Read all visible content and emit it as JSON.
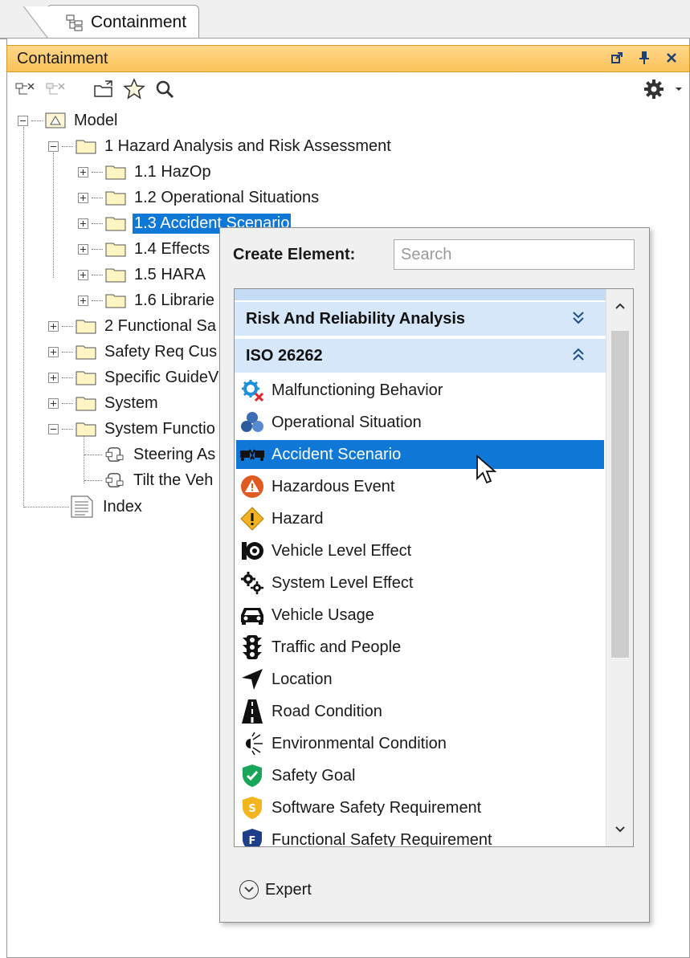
{
  "tab": {
    "label": "Containment",
    "icon": "containment-tree-icon"
  },
  "panel": {
    "title": "Containment",
    "window_buttons": [
      "restore-icon",
      "pin-icon",
      "close-icon"
    ]
  },
  "toolbar": {
    "icons": [
      "collapse-all-icon",
      "expand-all-icon",
      "open-project-icon",
      "favorite-star-icon",
      "search-icon",
      "gear-icon",
      "dropdown-arrow-icon"
    ]
  },
  "tree": {
    "root": "Model",
    "nodes": [
      {
        "label": "1 Hazard Analysis and Risk Assessment"
      },
      {
        "label": "1.1 HazOp"
      },
      {
        "label": "1.2 Operational Situations"
      },
      {
        "label": "1.3 Accident Scenario",
        "selected": true
      },
      {
        "label": "1.4 Effects"
      },
      {
        "label": "1.5 HARA"
      },
      {
        "label": "1.6 Librarie"
      },
      {
        "label": "2 Functional Sa"
      },
      {
        "label": "Safety Req Cus"
      },
      {
        "label": "Specific GuideV"
      },
      {
        "label": "System"
      },
      {
        "label": "System Functio"
      },
      {
        "label": "Steering As"
      },
      {
        "label": "Tilt the Veh"
      },
      {
        "label": "Index"
      }
    ]
  },
  "popup": {
    "label": "Create Element:",
    "search_placeholder": "Search",
    "categories": [
      {
        "label": "Risk And Reliability Analysis",
        "state": "collapsed"
      },
      {
        "label": "ISO 26262",
        "state": "expanded"
      }
    ],
    "items": [
      {
        "label": "Malfunctioning Behavior",
        "icon": "malfunction-gear-icon"
      },
      {
        "label": "Operational Situation",
        "icon": "operational-situation-icon"
      },
      {
        "label": "Accident Scenario",
        "icon": "accident-scenario-icon",
        "highlighted": true
      },
      {
        "label": "Hazardous Event",
        "icon": "hazardous-event-icon"
      },
      {
        "label": "Hazard",
        "icon": "hazard-icon"
      },
      {
        "label": "Vehicle Level Effect",
        "icon": "vehicle-level-effect-icon"
      },
      {
        "label": "System Level Effect",
        "icon": "system-level-effect-icon"
      },
      {
        "label": "Vehicle Usage",
        "icon": "car-icon"
      },
      {
        "label": "Traffic and People",
        "icon": "traffic-light-icon"
      },
      {
        "label": "Location",
        "icon": "location-arrow-icon"
      },
      {
        "label": "Road Condition",
        "icon": "road-icon"
      },
      {
        "label": "Environmental Condition",
        "icon": "environment-icon"
      },
      {
        "label": "Safety Goal",
        "icon": "safety-goal-shield-icon"
      },
      {
        "label": "Software Safety Requirement",
        "icon": "software-safety-shield-icon"
      },
      {
        "label": "Functional Safety Requirement",
        "icon": "functional-safety-shield-icon"
      }
    ],
    "expert_label": "Expert"
  },
  "colors": {
    "panel_title": "#fbc35a",
    "selection": "#0f78d7",
    "category_bg": "#d7e7fa"
  }
}
